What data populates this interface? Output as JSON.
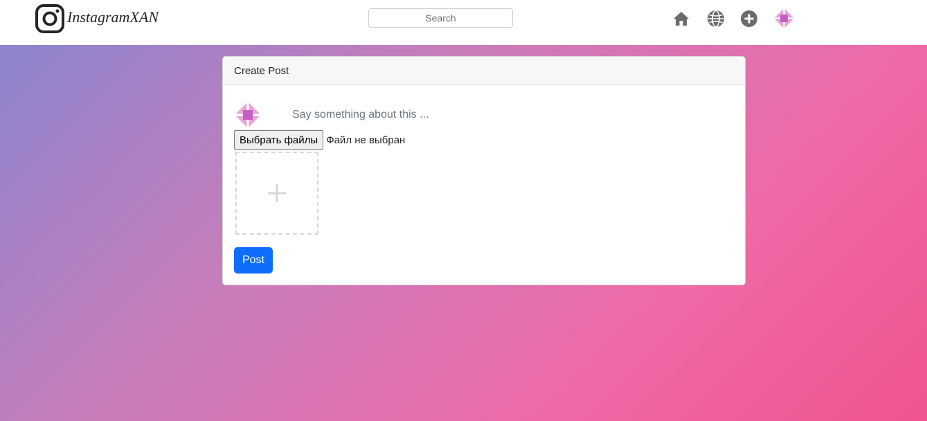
{
  "brand": {
    "name": "InstagramXAN",
    "logo_icon": "instagram-logo-icon"
  },
  "search": {
    "placeholder": "Search",
    "value": ""
  },
  "nav": {
    "icons": [
      "home-icon",
      "globe-icon",
      "add-circle-icon",
      "avatar-icon"
    ],
    "icon_color": "#6b6b6b"
  },
  "background": {
    "gradient": [
      "#8c84cc",
      "#c77dbb",
      "#ee6aa7",
      "#f05390"
    ]
  },
  "create_post": {
    "title": "Create Post",
    "caption_placeholder": "Say something about this ...",
    "caption_value": "",
    "file_button_label": "Выбрать файлы",
    "file_status": "Файл не выбран",
    "upload_icon": "plus-icon",
    "submit_label": "Post",
    "submit_color": "#0d6efd"
  },
  "avatar_colors": {
    "outer": "#e7a6d8",
    "inner": "#c55fc2"
  }
}
